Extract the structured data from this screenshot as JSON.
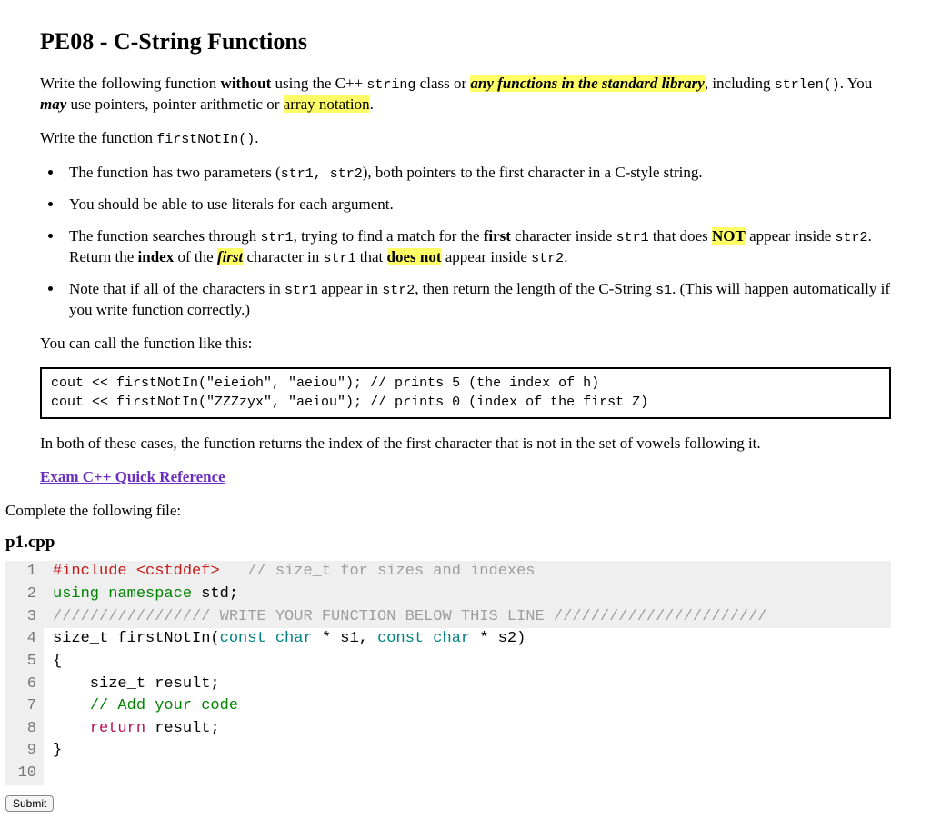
{
  "title": "PE08 - C-String Functions",
  "intro": {
    "pre1": "Write the following function ",
    "without": "without",
    "pre2": " using the C++ ",
    "string_kw": "string",
    "pre3": " class or ",
    "hl1": "any functions in the standard library",
    "pre4": ", including ",
    "strlen_kw": "strlen()",
    "pre5": ". You ",
    "may": "may",
    "pre6": " use pointers, pointer arithmetic or ",
    "hl2": "array notation",
    "pre7": "."
  },
  "writefn": {
    "a": "Write the function ",
    "b": "firstNotIn()",
    "c": "."
  },
  "bullets": {
    "b1": {
      "a": "The function has two parameters (",
      "p": "str1, str2",
      "b": "), both pointers to the first character in a C-style string."
    },
    "b2": "You should be able to use literals for each argument.",
    "b3": {
      "a": "The function searches through ",
      "s1": "str1",
      "b": ", trying to find a match for the ",
      "first": "first",
      "c": " character inside ",
      "s1b": "str1",
      "d": " that does ",
      "not": "NOT",
      "e": " appear inside ",
      "s2": "str2",
      "f": ". Return the ",
      "idx": "index",
      "g": " of the ",
      "firstI": "first",
      "h": " character in ",
      "s1c": "str1",
      "i": " that ",
      "dn": "does not",
      "j": " appear inside ",
      "s2b": "str2",
      "k": "."
    },
    "b4": {
      "a": "Note that if all of the characters in ",
      "s1": "str1",
      "b": " appear in ",
      "s2": "str2",
      "c": ", then return the length of the C-String ",
      "s1v": "s1",
      "d": ". (This will happen automatically if you write function correctly.)"
    }
  },
  "callIntro": "You can call the function like this:",
  "codebox": "cout << firstNotIn(\"eieioh\", \"aeiou\"); // prints 5 (the index of h)\ncout << firstNotIn(\"ZZZzyx\", \"aeiou\"); // prints 0 (index of the first Z)",
  "afterBox": "In both of these cases, the function returns the index of the first character that is not in the set of vowels following it.",
  "refLink": "Exam C++ Quick Reference",
  "complete": "Complete the following file:",
  "filename": "p1.cpp",
  "code": {
    "l1": {
      "a": "#include ",
      "b": "<cstddef>",
      "c": "   // size_t for sizes and indexes"
    },
    "l2": {
      "a": "using namespace ",
      "b": "std;"
    },
    "l3": "///////////////// WRITE YOUR FUNCTION BELOW THIS LINE ///////////////////////",
    "l4": {
      "a": "size_t firstNotIn(",
      "b": "const",
      "c": " char",
      "d": " * s1, ",
      "e": "const",
      "f": " char",
      "g": " * s2)"
    },
    "l5": "{",
    "l6": "    size_t result;",
    "l7": {
      "a": "    ",
      "b": "// Add your code"
    },
    "l8": {
      "a": "    ",
      "b": "return",
      "c": " result;"
    },
    "l9": "}",
    "l10": ""
  },
  "submit": "Submit"
}
